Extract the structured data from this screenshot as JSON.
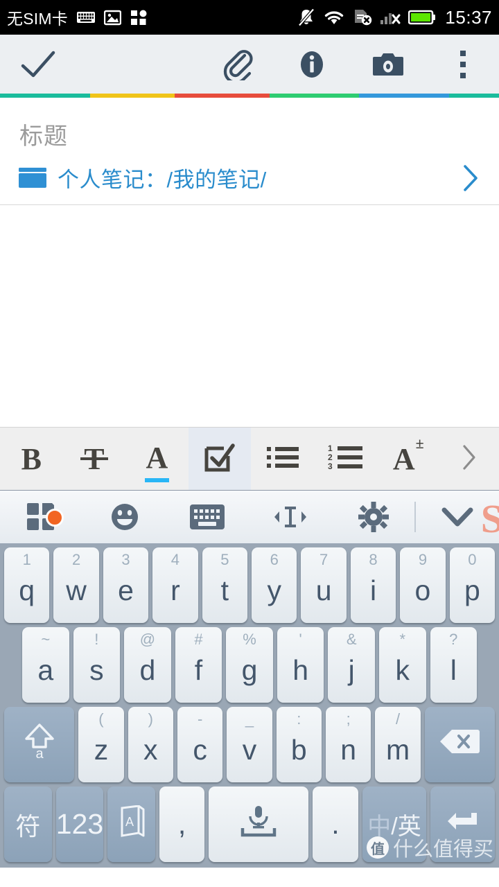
{
  "statusbar": {
    "carrier": "无SIM卡",
    "time": "15:37",
    "left_icons": [
      "keyboard-icon",
      "image-icon",
      "apps-icon"
    ],
    "right_icons": [
      "silent-bell-icon",
      "wifi-icon",
      "sim-disabled-icon",
      "signal-off-icon",
      "battery-icon"
    ],
    "battery_color": "#5ce600"
  },
  "apptoolbar": {
    "done_label": "check-icon",
    "attach_label": "paperclip-icon",
    "info_label": "info-icon",
    "camera_label": "camera-icon",
    "more_label": "overflow-menu-icon",
    "icon_color": "#3b4f63"
  },
  "colorbar": {
    "segments": [
      {
        "color": "#1abc9c",
        "width": 18
      },
      {
        "color": "#f0c419",
        "width": 17
      },
      {
        "color": "#e74c3c",
        "width": 19
      },
      {
        "color": "#2ecc71",
        "width": 18
      },
      {
        "color": "#3498db",
        "width": 18
      },
      {
        "color": "#1abc9c",
        "width": 10
      }
    ]
  },
  "editor": {
    "title_placeholder": "标题",
    "title_value": "",
    "notebook_path": "个人笔记：/我的笔记/",
    "path_color": "#2a8ccc",
    "folder_icon": "folder-icon",
    "chevron_icon": "chevron-right-icon",
    "body_value": ""
  },
  "formatbar": {
    "items": [
      {
        "name": "bold",
        "label": "B",
        "type": "bold",
        "active": false
      },
      {
        "name": "strike",
        "label": "T",
        "type": "strike",
        "active": false
      },
      {
        "name": "underline",
        "label": "A",
        "type": "underline",
        "active": false
      },
      {
        "name": "checkbox",
        "label": "",
        "type": "checkbox",
        "active": true
      },
      {
        "name": "bullet-list",
        "label": "",
        "type": "bullet",
        "active": false
      },
      {
        "name": "number-list",
        "label": "",
        "type": "number",
        "active": false
      },
      {
        "name": "font-size",
        "label": "A",
        "type": "fontsize",
        "active": false
      },
      {
        "name": "more",
        "label": "",
        "type": "chevron",
        "active": false
      }
    ],
    "active_bg": "#e5eaf2",
    "underline_color": "#29b6f6"
  },
  "keyboard_toolbar": {
    "items": [
      {
        "name": "apps-grid-icon",
        "badge": true
      },
      {
        "name": "emoji-icon",
        "badge": false
      },
      {
        "name": "keyboard-icon",
        "badge": false
      },
      {
        "name": "cursor-move-icon",
        "badge": false
      },
      {
        "name": "gear-icon",
        "badge": false
      },
      {
        "name": "collapse-keyboard-icon",
        "badge": false
      }
    ],
    "badge_color": "#f26522",
    "brand_mark": "S"
  },
  "keyboard": {
    "background": "#9aa7b5",
    "row1": [
      {
        "sub": "1",
        "main": "q"
      },
      {
        "sub": "2",
        "main": "w"
      },
      {
        "sub": "3",
        "main": "e"
      },
      {
        "sub": "4",
        "main": "r"
      },
      {
        "sub": "5",
        "main": "t"
      },
      {
        "sub": "6",
        "main": "y"
      },
      {
        "sub": "7",
        "main": "u"
      },
      {
        "sub": "8",
        "main": "i"
      },
      {
        "sub": "9",
        "main": "o"
      },
      {
        "sub": "0",
        "main": "p"
      }
    ],
    "row2": [
      {
        "sub": "~",
        "main": "a"
      },
      {
        "sub": "!",
        "main": "s"
      },
      {
        "sub": "@",
        "main": "d"
      },
      {
        "sub": "#",
        "main": "f"
      },
      {
        "sub": "%",
        "main": "g"
      },
      {
        "sub": "'",
        "main": "h"
      },
      {
        "sub": "&",
        "main": "j"
      },
      {
        "sub": "*",
        "main": "k"
      },
      {
        "sub": "?",
        "main": "l"
      }
    ],
    "row3": [
      {
        "sub": "",
        "main": "",
        "name": "shift-key",
        "icon": "shift-icon",
        "shift_letter": "a",
        "dark": true,
        "wide": true
      },
      {
        "sub": "(",
        "main": "z",
        "name": "key-z"
      },
      {
        "sub": ")",
        "main": "x",
        "name": "key-x"
      },
      {
        "sub": "-",
        "main": "c",
        "name": "key-c"
      },
      {
        "sub": "_",
        "main": "v",
        "name": "key-v"
      },
      {
        "sub": ":",
        "main": "b",
        "name": "key-b"
      },
      {
        "sub": ";",
        "main": "n",
        "name": "key-n"
      },
      {
        "sub": "/",
        "main": "m",
        "name": "key-m"
      },
      {
        "sub": "",
        "main": "",
        "name": "backspace-key",
        "icon": "backspace-icon",
        "dark": true,
        "wide": true
      }
    ],
    "row4": [
      {
        "label": "符",
        "name": "symbols-key",
        "dark": true
      },
      {
        "label": "123",
        "name": "numbers-key",
        "dark": true
      },
      {
        "label": "",
        "name": "dictionary-key",
        "icon": "book-icon",
        "dark": true
      },
      {
        "label": ",",
        "name": "comma-key",
        "dark": false
      },
      {
        "label": "",
        "name": "space-key",
        "icon": "mic-space-icon",
        "dark": false
      },
      {
        "label": ".",
        "name": "period-key",
        "dark": false
      },
      {
        "label": "中/英",
        "name": "language-toggle-key",
        "dark": true
      },
      {
        "label": "",
        "name": "enter-key",
        "icon": "enter-icon",
        "dark": true
      }
    ]
  },
  "watermark": {
    "text": "什么值得买",
    "logo": "值"
  }
}
